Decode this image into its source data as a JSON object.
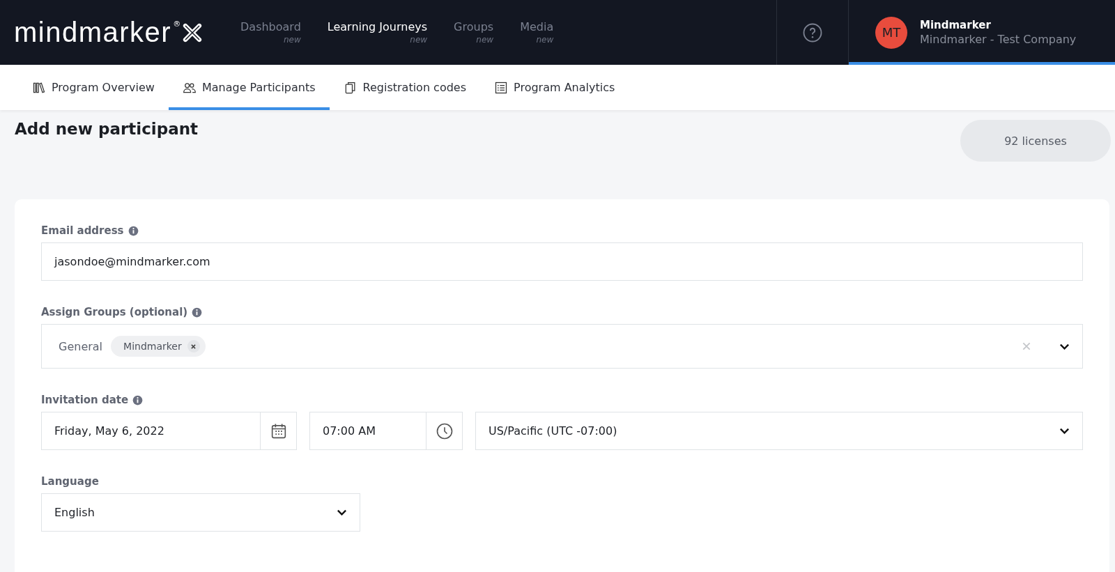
{
  "header": {
    "logo": {
      "text": "mindmarker",
      "mark": "®"
    },
    "nav": [
      {
        "label": "Dashboard",
        "badge": "new",
        "selected": false
      },
      {
        "label": "Learning Journeys",
        "badge": "new",
        "selected": true
      },
      {
        "label": "Groups",
        "badge": "new",
        "selected": false
      },
      {
        "label": "Media",
        "badge": "new",
        "selected": false
      }
    ],
    "account": {
      "initials": "MT",
      "name": "Mindmarker",
      "company": "Mindmarker - Test Company",
      "selected": true
    }
  },
  "tabs": [
    {
      "label": "Program Overview",
      "selected": false
    },
    {
      "label": "Manage Participants",
      "selected": true
    },
    {
      "label": "Registration codes",
      "selected": false
    },
    {
      "label": "Program Analytics",
      "selected": false
    }
  ],
  "page": {
    "title": "Add new participant",
    "licenses": "92 licenses"
  },
  "form": {
    "email": {
      "label": "Email address",
      "value": "jasondoe@mindmarker.com"
    },
    "groups": {
      "label": "Assign Groups (optional)",
      "category": "General",
      "tags": [
        "Mindmarker"
      ]
    },
    "invitation": {
      "label": "Invitation date",
      "date": "Friday, May 6, 2022",
      "time": "07:00 AM",
      "timezone": "US/Pacific (UTC -07:00)"
    },
    "language": {
      "label": "Language",
      "value": "English"
    }
  }
}
